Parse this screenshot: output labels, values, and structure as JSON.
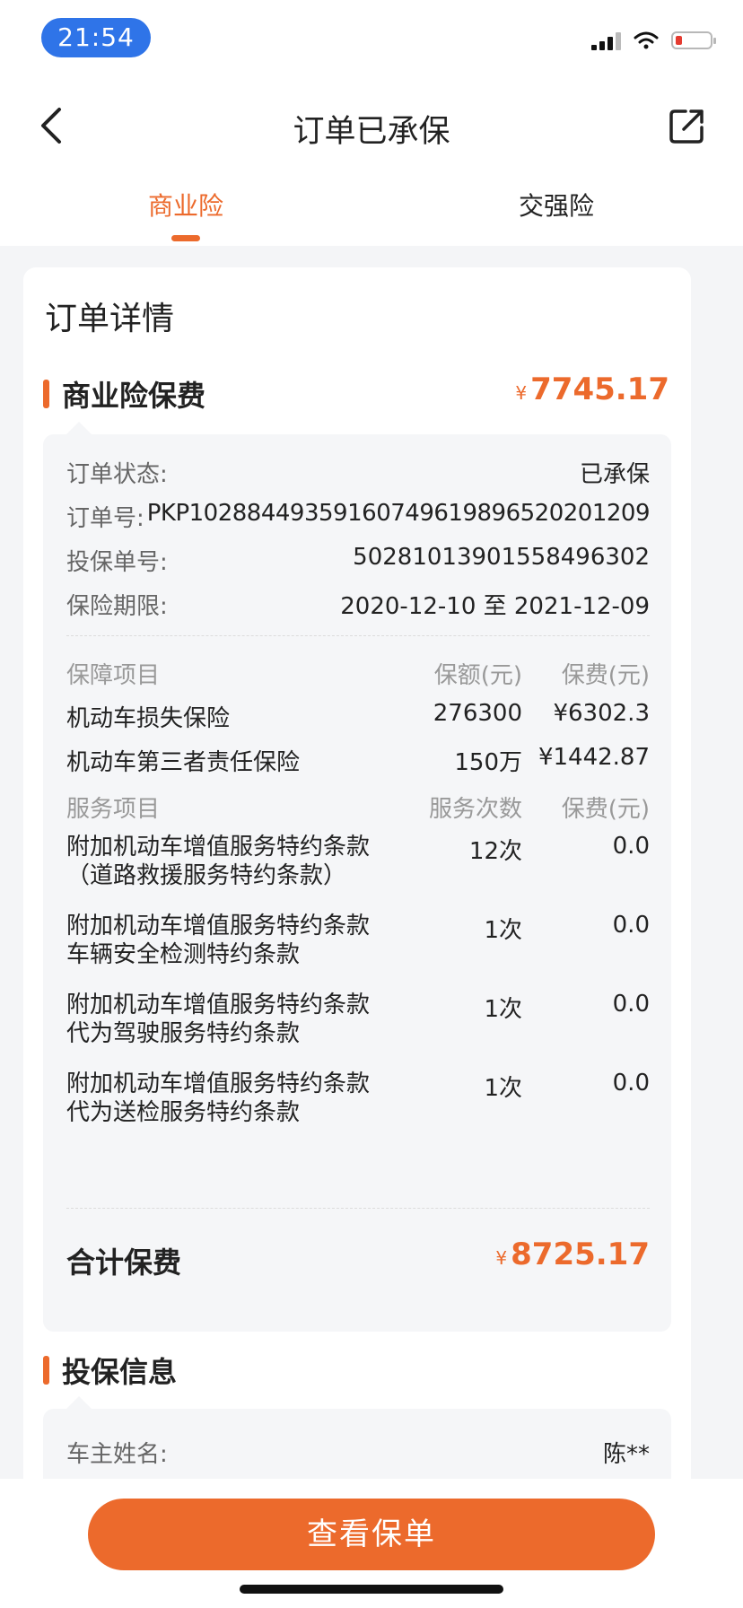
{
  "status_bar": {
    "time": "21:54"
  },
  "nav": {
    "title": "订单已承保"
  },
  "tabs": [
    {
      "label": "商业险",
      "active": true
    },
    {
      "label": "交强险",
      "active": false
    }
  ],
  "card": {
    "title": "订单详情",
    "commercial_section": {
      "title": "商业险保费",
      "currency": "¥",
      "premium": "7745.17"
    },
    "details": [
      {
        "label": "订单状态:",
        "value": "已承保"
      },
      {
        "label": "订单号:",
        "value": "PKP10288449359160749619896520201209"
      },
      {
        "label": "投保单号:",
        "value": "50281013901558496302"
      },
      {
        "label": "保险期限:",
        "value": "2020-12-10 至 2021-12-09"
      }
    ],
    "coverage_header": {
      "item": "保障项目",
      "amount": "保额(元)",
      "fee": "保费(元)"
    },
    "coverage_items": [
      {
        "name": "机动车损失保险",
        "amount": "276300",
        "fee": "¥6302.3"
      },
      {
        "name": "机动车第三者责任保险",
        "amount": "150万",
        "fee": "¥1442.87"
      }
    ],
    "service_header": {
      "item": "服务项目",
      "count": "服务次数",
      "fee": "保费(元)"
    },
    "service_items": [
      {
        "line1": "附加机动车增值服务特约条款",
        "line2": "（道路救援服务特约条款）",
        "count": "12次",
        "fee": "0.0"
      },
      {
        "line1": "附加机动车增值服务特约条款",
        "line2": "车辆安全检测特约条款",
        "count": "1次",
        "fee": "0.0"
      },
      {
        "line1": "附加机动车增值服务特约条款",
        "line2": "代为驾驶服务特约条款",
        "count": "1次",
        "fee": "0.0"
      },
      {
        "line1": "附加机动车增值服务特约条款",
        "line2": "代为送检服务特约条款",
        "count": "1次",
        "fee": "0.0"
      }
    ],
    "total": {
      "label": "合计保费",
      "currency": "¥",
      "value": "8725.17"
    },
    "insured_section": {
      "title": "投保信息",
      "rows": [
        {
          "label": "车主姓名:",
          "value": "陈**"
        }
      ]
    }
  },
  "bottom": {
    "cta_label": "查看保单"
  },
  "colors": {
    "accent": "#ec6a2c",
    "time_pill": "#2f74e8"
  }
}
